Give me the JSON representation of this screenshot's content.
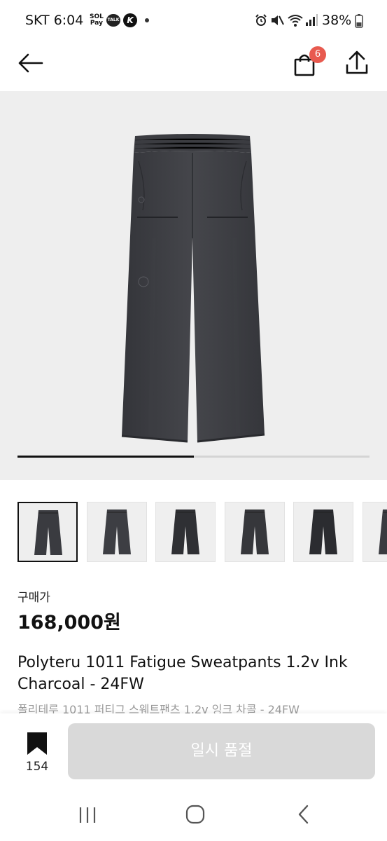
{
  "status_bar": {
    "time": "SKT 6:04",
    "pay_top": "SOL",
    "pay_bottom": "Pay",
    "talk": "TALK",
    "k": "K",
    "battery": "38%"
  },
  "header": {
    "cart_count": "6"
  },
  "gallery": {
    "progress": 0.5,
    "thumbnail_count": 6,
    "selected_index": 0
  },
  "product": {
    "price_label": "구매가",
    "price": "168,000원",
    "title_en": "Polyteru 1011 Fatigue Sweatpants 1.2v Ink Charcoal - 24FW",
    "title_ko": "폴리테루 1011 퍼티그 스웨트팬츠 1.2v 잉크 차콜 - 24FW"
  },
  "actions": {
    "bookmark_count": "154",
    "soldout_label": "일시 품절"
  },
  "colors": {
    "badge": "#e85a4f",
    "soldout_bg": "#d9d9d9",
    "pants": "#3a3b3f"
  }
}
